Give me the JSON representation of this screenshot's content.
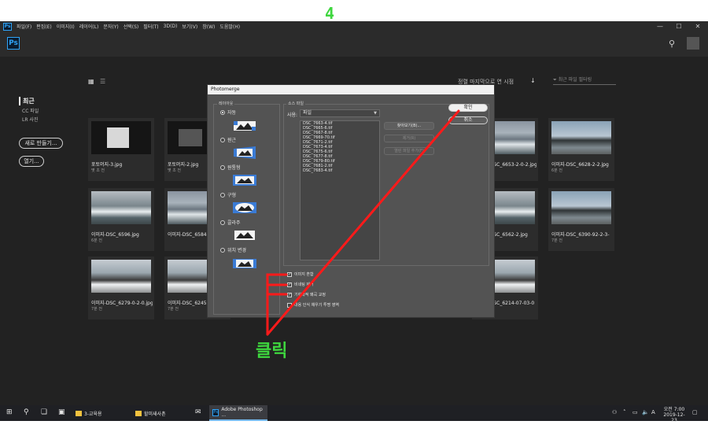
{
  "step_label": "4",
  "menu": [
    "파일(F)",
    "편집(E)",
    "이미지(I)",
    "레이어(L)",
    "문자(Y)",
    "선택(S)",
    "필터(T)",
    "3D(D)",
    "보기(V)",
    "창(W)",
    "도움말(H)"
  ],
  "app_logo": "Ps",
  "window_controls": {
    "minimize": "—",
    "maximize": "☐",
    "close": "✕"
  },
  "home": {
    "sidebar": {
      "recent": "최근",
      "cc_files": "CC 파일",
      "lr_photos": "LR 사진",
      "new_button": "새로 만들기...",
      "open_button": "열기..."
    },
    "sort_label": "정렬 마지막으로 연 시점",
    "filter_placeholder": "최근 파일 필터링",
    "cards": [
      {
        "name": "포토머지-3.jpg",
        "time": "몇 초 전"
      },
      {
        "name": "포토머지-2.jpg",
        "time": "몇 초 전"
      },
      {
        "name": "이미지-DSC_6653-2-0-2.jpg",
        "time": ""
      },
      {
        "name": "이미지-DSC_6628-2-2.jpg",
        "time": "6분 전"
      },
      {
        "name": "이미지-DSC_6596.jpg",
        "time": "6분 전"
      },
      {
        "name": "이미지-DSC_6584",
        "time": ""
      },
      {
        "name": "이미지-DSC_6562-2.jpg",
        "time": ""
      },
      {
        "name": "이미지-DSC_6390-92-2-3-",
        "time": "7분 전"
      },
      {
        "name": "이미지-DSC_6279-0-2-0.jpg",
        "time": "7분 전"
      },
      {
        "name": "이미지-DSC_6245",
        "time": "7분 전"
      },
      {
        "name": "이미지-DSC_6214-07-03-0",
        "time": ""
      }
    ]
  },
  "dialog": {
    "title": "Photomerge",
    "layout_group": "레이아웃",
    "layouts": [
      {
        "label": "자동",
        "selected": true
      },
      {
        "label": "원근",
        "selected": false
      },
      {
        "label": "원통형",
        "selected": false
      },
      {
        "label": "구형",
        "selected": false
      },
      {
        "label": "콜라주",
        "selected": false
      },
      {
        "label": "위치 변경",
        "selected": false
      }
    ],
    "source_group": "소스 파일",
    "use_label": "사용:",
    "use_value": "파일",
    "files": [
      "DSC_7663-4.tif",
      "DSC_7665-6.tif",
      "DSC_7667-8.tif",
      "DSC_7669-70.tif",
      "DSC_7671-2.tif",
      "DSC_7673-4.tif",
      "DSC_7675-6.tif",
      "DSC_7677-8.tif",
      "DSC_7679-80.tif",
      "DSC_7681-2.tif",
      "DSC_7683-4.tif"
    ],
    "browse_button": "찾아보기(B)...",
    "remove_button": "제거(R)",
    "add_open_button": "열린 파일 추가(F)",
    "options": [
      {
        "label": "이미지 혼합",
        "checked": true
      },
      {
        "label": "비네팅 제거",
        "checked": true
      },
      {
        "label": "기하학적 왜곡 교정",
        "checked": true
      },
      {
        "label": "내용 인식 채우기 투명 영역",
        "checked": false
      }
    ],
    "ok_button": "확인",
    "cancel_button": "취소"
  },
  "annotation_text": "클릭",
  "annotation_color": "#ff1a1a",
  "taskbar": {
    "apps": [
      {
        "label": "3-교육용",
        "kind": "folder"
      },
      {
        "label": "할미새사촌",
        "kind": "folder"
      },
      {
        "label": "Adobe Photoshop ...",
        "kind": "ps"
      }
    ],
    "time": "오전 7:00",
    "date": "2019-12-23"
  }
}
